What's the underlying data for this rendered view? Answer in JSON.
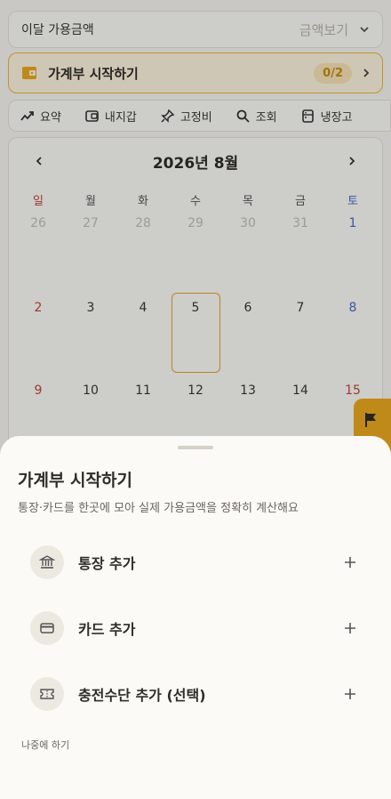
{
  "budget": {
    "label": "이달 가용금액",
    "view": "금액보기"
  },
  "banner": {
    "title": "가계부 시작하기",
    "progress": "0/2"
  },
  "tabs": [
    {
      "label": "요약",
      "icon": "trend-icon"
    },
    {
      "label": "내지갑",
      "icon": "wallet-icon"
    },
    {
      "label": "고정비",
      "icon": "pin-icon"
    },
    {
      "label": "조회",
      "icon": "search-icon"
    },
    {
      "label": "냉장고",
      "icon": "fridge-icon"
    }
  ],
  "calendar": {
    "month": "2026년 8월",
    "weekdays": [
      "일",
      "월",
      "화",
      "수",
      "목",
      "금",
      "토"
    ],
    "week1": [
      "26",
      "27",
      "28",
      "29",
      "30",
      "31",
      "1"
    ],
    "week2": [
      "2",
      "3",
      "4",
      "5",
      "6",
      "7",
      "8"
    ],
    "week3": [
      "9",
      "10",
      "11",
      "12",
      "13",
      "14",
      "15"
    ]
  },
  "sheet": {
    "title": "가계부 시작하기",
    "subtitle": "통장·카드를 한곳에 모아 실제 가용금액을 정확히 계산해요",
    "options": [
      {
        "label": "통장 추가",
        "icon": "bank-icon"
      },
      {
        "label": "카드 추가",
        "icon": "card-icon"
      },
      {
        "label": "충전수단 추가 (선택)",
        "icon": "ticket-icon"
      }
    ],
    "later": "나중에 하기"
  },
  "colors": {
    "accent": "#e9a91f",
    "sunday": "#c0463c",
    "saturday": "#4a68c6"
  }
}
